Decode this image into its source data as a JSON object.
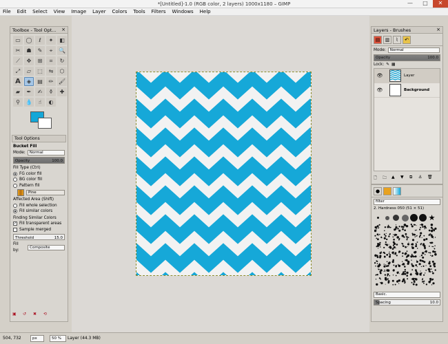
{
  "window": {
    "title": "*[Untitled]-1.0 (RGB color, 2 layers) 1000x1180 – GIMP",
    "minimize": "—",
    "maximize": "□",
    "close": "✕"
  },
  "menu": [
    "File",
    "Edit",
    "Select",
    "View",
    "Image",
    "Layer",
    "Colors",
    "Tools",
    "Filters",
    "Windows",
    "Help"
  ],
  "toolbox": {
    "title": "Toolbox - Tool Opt...",
    "close": "×",
    "fg_color": "#14a7d8",
    "bg_color": "#ffffff",
    "options_tab": "Tool Options",
    "tool_name": "Bucket Fill",
    "mode_label": "Mode:",
    "mode_value": "Normal",
    "opacity_label": "Opacity",
    "opacity_value": "100.0",
    "fill_type_label": "Fill Type  (Ctrl)",
    "fill_types": [
      "FG color fill",
      "BG color fill",
      "Pattern fill"
    ],
    "pattern_name": "Pine",
    "affected_label": "Affected Area  (Shift)",
    "affected": [
      "Fill whole selection",
      "Fill similar colors"
    ],
    "finding_label": "Finding Similar Colors",
    "fill_transparent": "Fill transparent areas",
    "sample_merged": "Sample merged",
    "threshold_label": "Threshold",
    "threshold_value": "15.0",
    "fill_by_label": "Fill by:",
    "fill_by_value": "Composite"
  },
  "layers": {
    "title": "Layers - Brushes",
    "mode_label": "Mode:",
    "mode_value": "Normal",
    "opacity_label": "Opacity",
    "opacity_value": "100.0",
    "lock_label": "Lock:",
    "items": [
      {
        "name": "Layer",
        "visible_icon": "eye-icon"
      },
      {
        "name": "Background",
        "visible_icon": "eye-icon"
      }
    ]
  },
  "brushes": {
    "filter_placeholder": "filter",
    "brush_name": "2. Hardness 050 (51 × 51)",
    "preset": "Basic.",
    "spacing_label": "Spacing",
    "spacing_value": "10.0"
  },
  "status": {
    "coords": "504, 732",
    "unit": "px",
    "zoom": "50 %",
    "layer_info": "Layer (44.3 MB)"
  },
  "colors": {
    "chevron": "#16a8d8",
    "chevron_bg": "#f2f2f2",
    "canvas_bg": "#dcd9d5"
  }
}
